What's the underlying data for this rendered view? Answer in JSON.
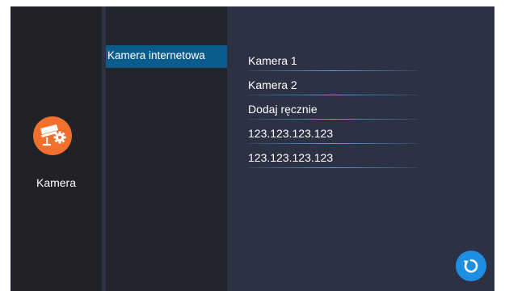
{
  "sidebar": {
    "category_label": "Kamera",
    "category_icon": "camera-settings-icon",
    "accent_color": "#f0702c"
  },
  "submenu": {
    "items": [
      {
        "label": "Kamera internetowa",
        "selected": true
      }
    ],
    "selected_color": "#0b5c8c"
  },
  "camera_list": {
    "items": [
      {
        "label": "Kamera 1"
      },
      {
        "label": "Kamera 2"
      },
      {
        "label": "Dodaj ręcznie"
      },
      {
        "label": "123.123.123.123"
      },
      {
        "label": "123.123.123.123"
      }
    ]
  },
  "refresh_button": {
    "icon": "refresh-icon",
    "color": "#1e8ee3"
  }
}
